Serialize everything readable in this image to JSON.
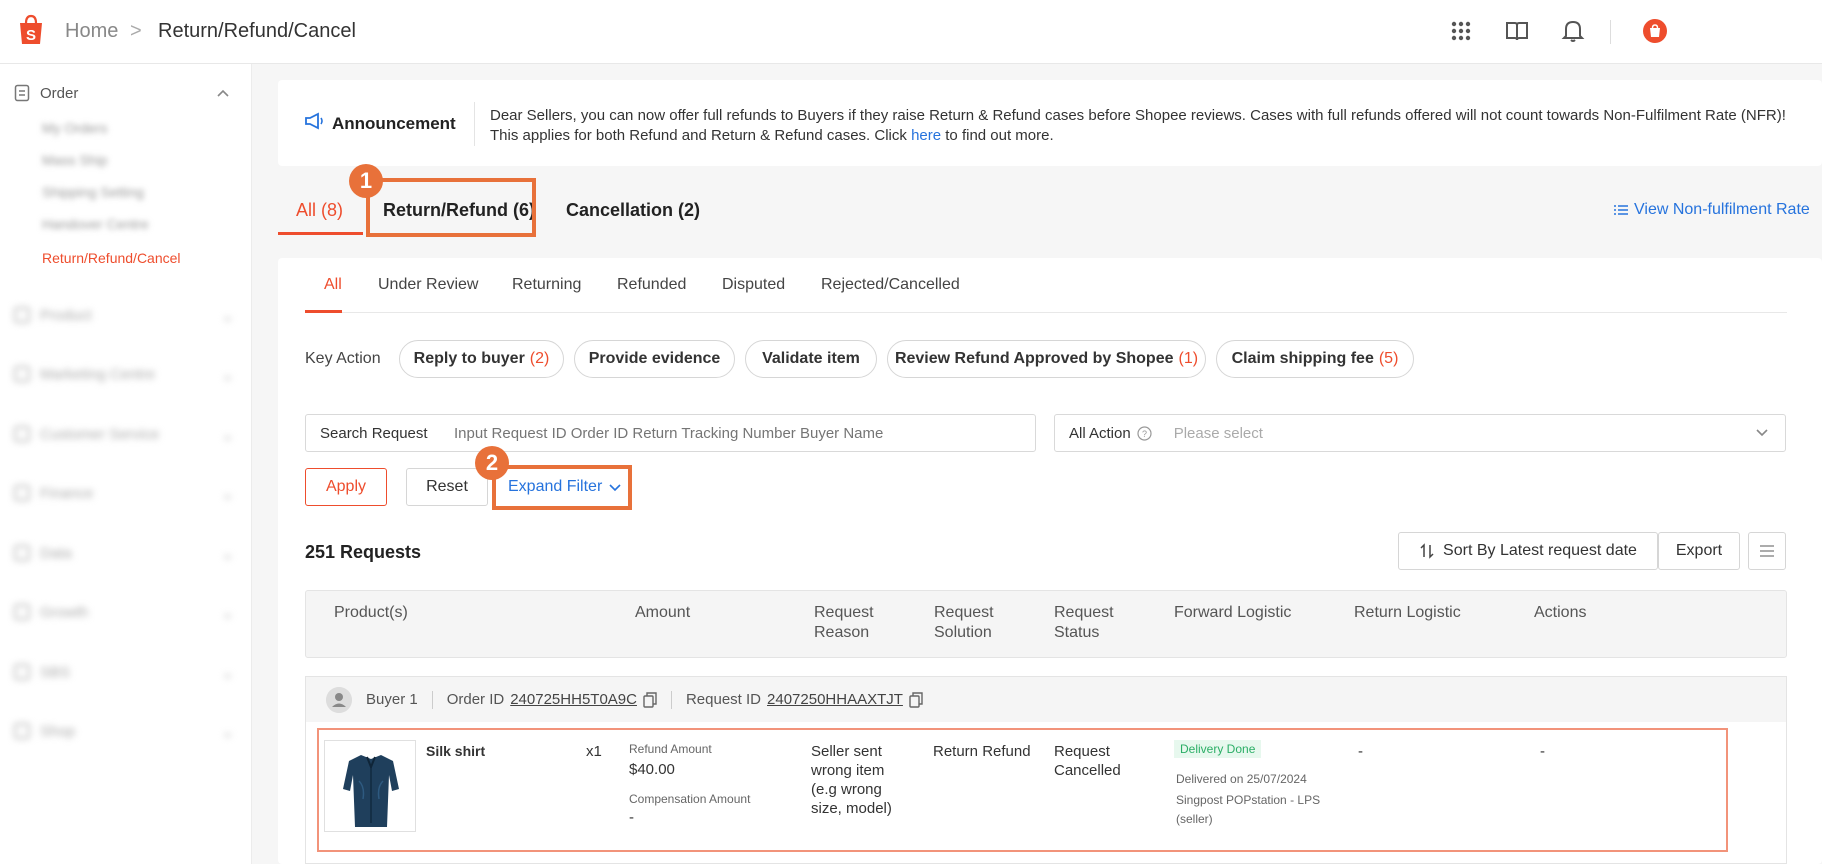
{
  "breadcrumb": {
    "home": "Home",
    "separator": ">",
    "current": "Return/Refund/Cancel"
  },
  "topbar": {
    "icons": [
      "apps-grid-icon",
      "book-icon",
      "bell-icon",
      "shop-avatar-icon"
    ]
  },
  "sidebar": {
    "section": "Order",
    "items": [
      "My Orders",
      "Mass Ship",
      "Shipping Setting",
      "Handover Centre"
    ],
    "active": "Return/Refund/Cancel",
    "sections": [
      "Product",
      "Marketing Centre",
      "Customer Service",
      "Finance",
      "Data",
      "Growth",
      "SBS",
      "Shop"
    ]
  },
  "announcement": {
    "title": "Announcement",
    "text_before": "Dear Sellers, you can now offer full refunds to Buyers if they raise Return & Refund cases before Shopee reviews. Cases with full refunds offered will not count towards Non-Fulfilment Rate (NFR)! This applies for both Refund and Return & Refund cases. Click ",
    "link": "here",
    "text_after": " to find out more."
  },
  "tabs": {
    "all": "All (8)",
    "return_refund": "Return/Refund (6)",
    "cancellation": "Cancellation (2)",
    "view_nfr": "View Non-fulfilment Rate"
  },
  "step_badges": {
    "one": "1",
    "two": "2"
  },
  "sub_tabs": [
    "All",
    "Under Review",
    "Returning",
    "Refunded",
    "Disputed",
    "Rejected/Cancelled"
  ],
  "key_action": {
    "label": "Key Action",
    "pills": [
      {
        "label": "Reply to buyer",
        "count": "(2)"
      },
      {
        "label": "Provide evidence",
        "count": ""
      },
      {
        "label": "Validate item",
        "count": ""
      },
      {
        "label": "Review Refund Approved by Shopee",
        "count": "(1)"
      },
      {
        "label": "Claim shipping fee",
        "count": "(5)"
      }
    ]
  },
  "search": {
    "label": "Search Request",
    "placeholder": "Input Request ID Order ID Return Tracking Number Buyer Name"
  },
  "action_filter": {
    "label": "All Action",
    "placeholder": "Please select"
  },
  "buttons": {
    "apply": "Apply",
    "reset": "Reset",
    "expand": "Expand Filter",
    "sort": "Sort By Latest request date",
    "export": "Export"
  },
  "results": {
    "count_label": "251 Requests"
  },
  "table": {
    "headers": [
      "Product(s)",
      "Amount",
      "Request\nReason",
      "Request\nSolution",
      "Request\nStatus",
      "Forward Logistic",
      "Return Logistic",
      "Actions"
    ]
  },
  "order": {
    "buyer": "Buyer 1",
    "order_id_label": "Order ID",
    "order_id": "240725HH5T0A9C",
    "request_id_label": "Request ID",
    "request_id": "2407250HHAAXTJT",
    "product_name": "Silk shirt",
    "quantity": "x1",
    "refund_amount_label": "Refund Amount",
    "refund_amount": "$40.00",
    "compensation_label": "Compensation Amount",
    "compensation_amount": "-",
    "reason": "Seller sent wrong item (e.g wrong size, model)",
    "solution": "Return Refund",
    "status": "Request Cancelled",
    "delivery_badge": "Delivery Done",
    "delivered_on": "Delivered on 25/07/2024",
    "logistic_name": "Singpost POPstation - LPS (seller)",
    "return_logistic": "-",
    "actions": "-"
  },
  "colors": {
    "brand": "#ee4d2d",
    "link": "#2673dd",
    "highlight": "#e8713a",
    "success": "#2bae66"
  }
}
